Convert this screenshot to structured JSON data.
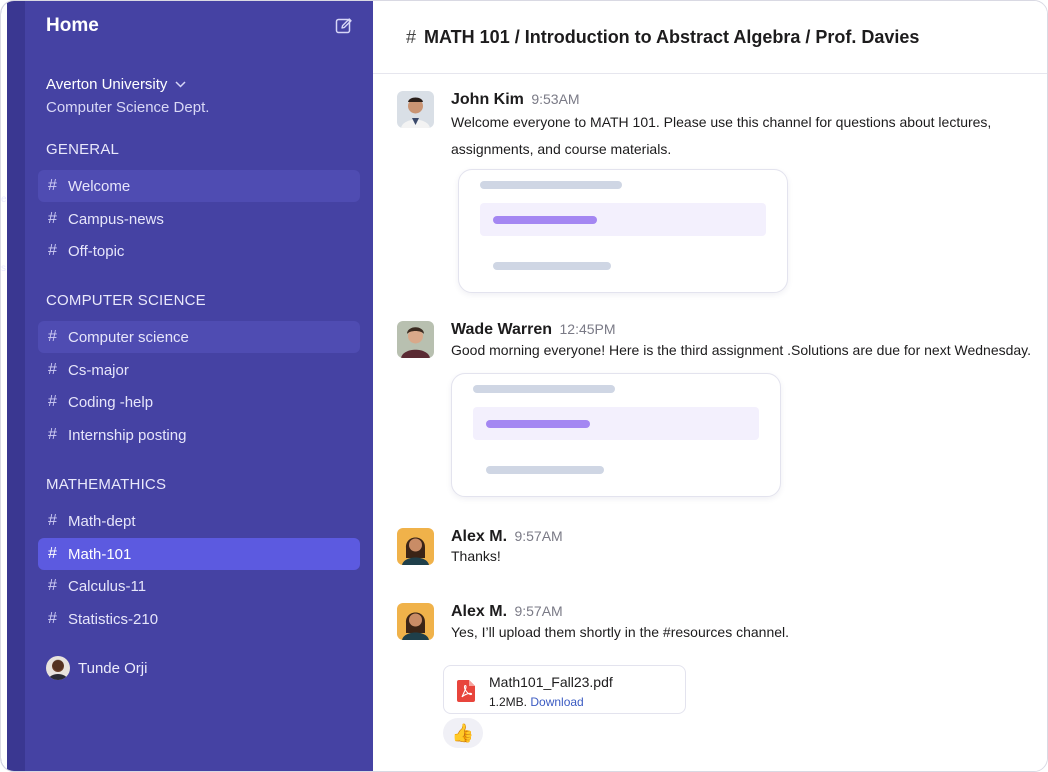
{
  "sidebar": {
    "home_label": "Home",
    "org_name": "Averton University",
    "org_sub": "Computer Science Dept.",
    "sections": [
      {
        "title": "GENERAL",
        "channels": [
          "Welcome",
          "Campus-news",
          "Off-topic"
        ]
      },
      {
        "title": "COMPUTER SCIENCE",
        "channels": [
          "Computer science",
          "Cs-major",
          "Coding -help",
          "Internship posting"
        ]
      },
      {
        "title": "MATHEMATHICS",
        "channels": [
          "Math-dept",
          "Math-101",
          "Calculus-11",
          "Statistics-210"
        ]
      }
    ],
    "active_channel": "Math-101",
    "user_name": "Tunde Orji"
  },
  "header": {
    "hash": "#",
    "title": "MATH 101 / Introduction to Abstract Algebra / Prof. Davies"
  },
  "messages": [
    {
      "author": "John Kim",
      "time": "9:53AM",
      "text": "Welcome everyone to MATH 101. Please use this channel for questions about lectures, assignments, and course materials."
    },
    {
      "author": "Wade Warren",
      "time": "12:45PM",
      "text": "Good morning everyone! Here is the third assignment .Solutions are due for next Wednesday."
    },
    {
      "author": "Alex M.",
      "time": "9:57AM",
      "text": "Thanks!"
    },
    {
      "author": "Alex M.",
      "time": "9:57AM",
      "text": "Yes, I’ll upload them shortly in the #resources channel."
    }
  ],
  "attachment": {
    "file_name": "Math101_Fall23.pdf",
    "size": "1.2MB.",
    "download_label": "Download"
  },
  "reaction": {
    "emoji": "👍"
  },
  "rail_fragments": [
    "e",
    "s"
  ],
  "colors": {
    "sidebar_bg": "#4542a3",
    "active_channel_bg": "#5c5ae0",
    "accent_purple": "#a487f2",
    "link": "#3b5bc2",
    "pdf_red": "#e8453c"
  }
}
